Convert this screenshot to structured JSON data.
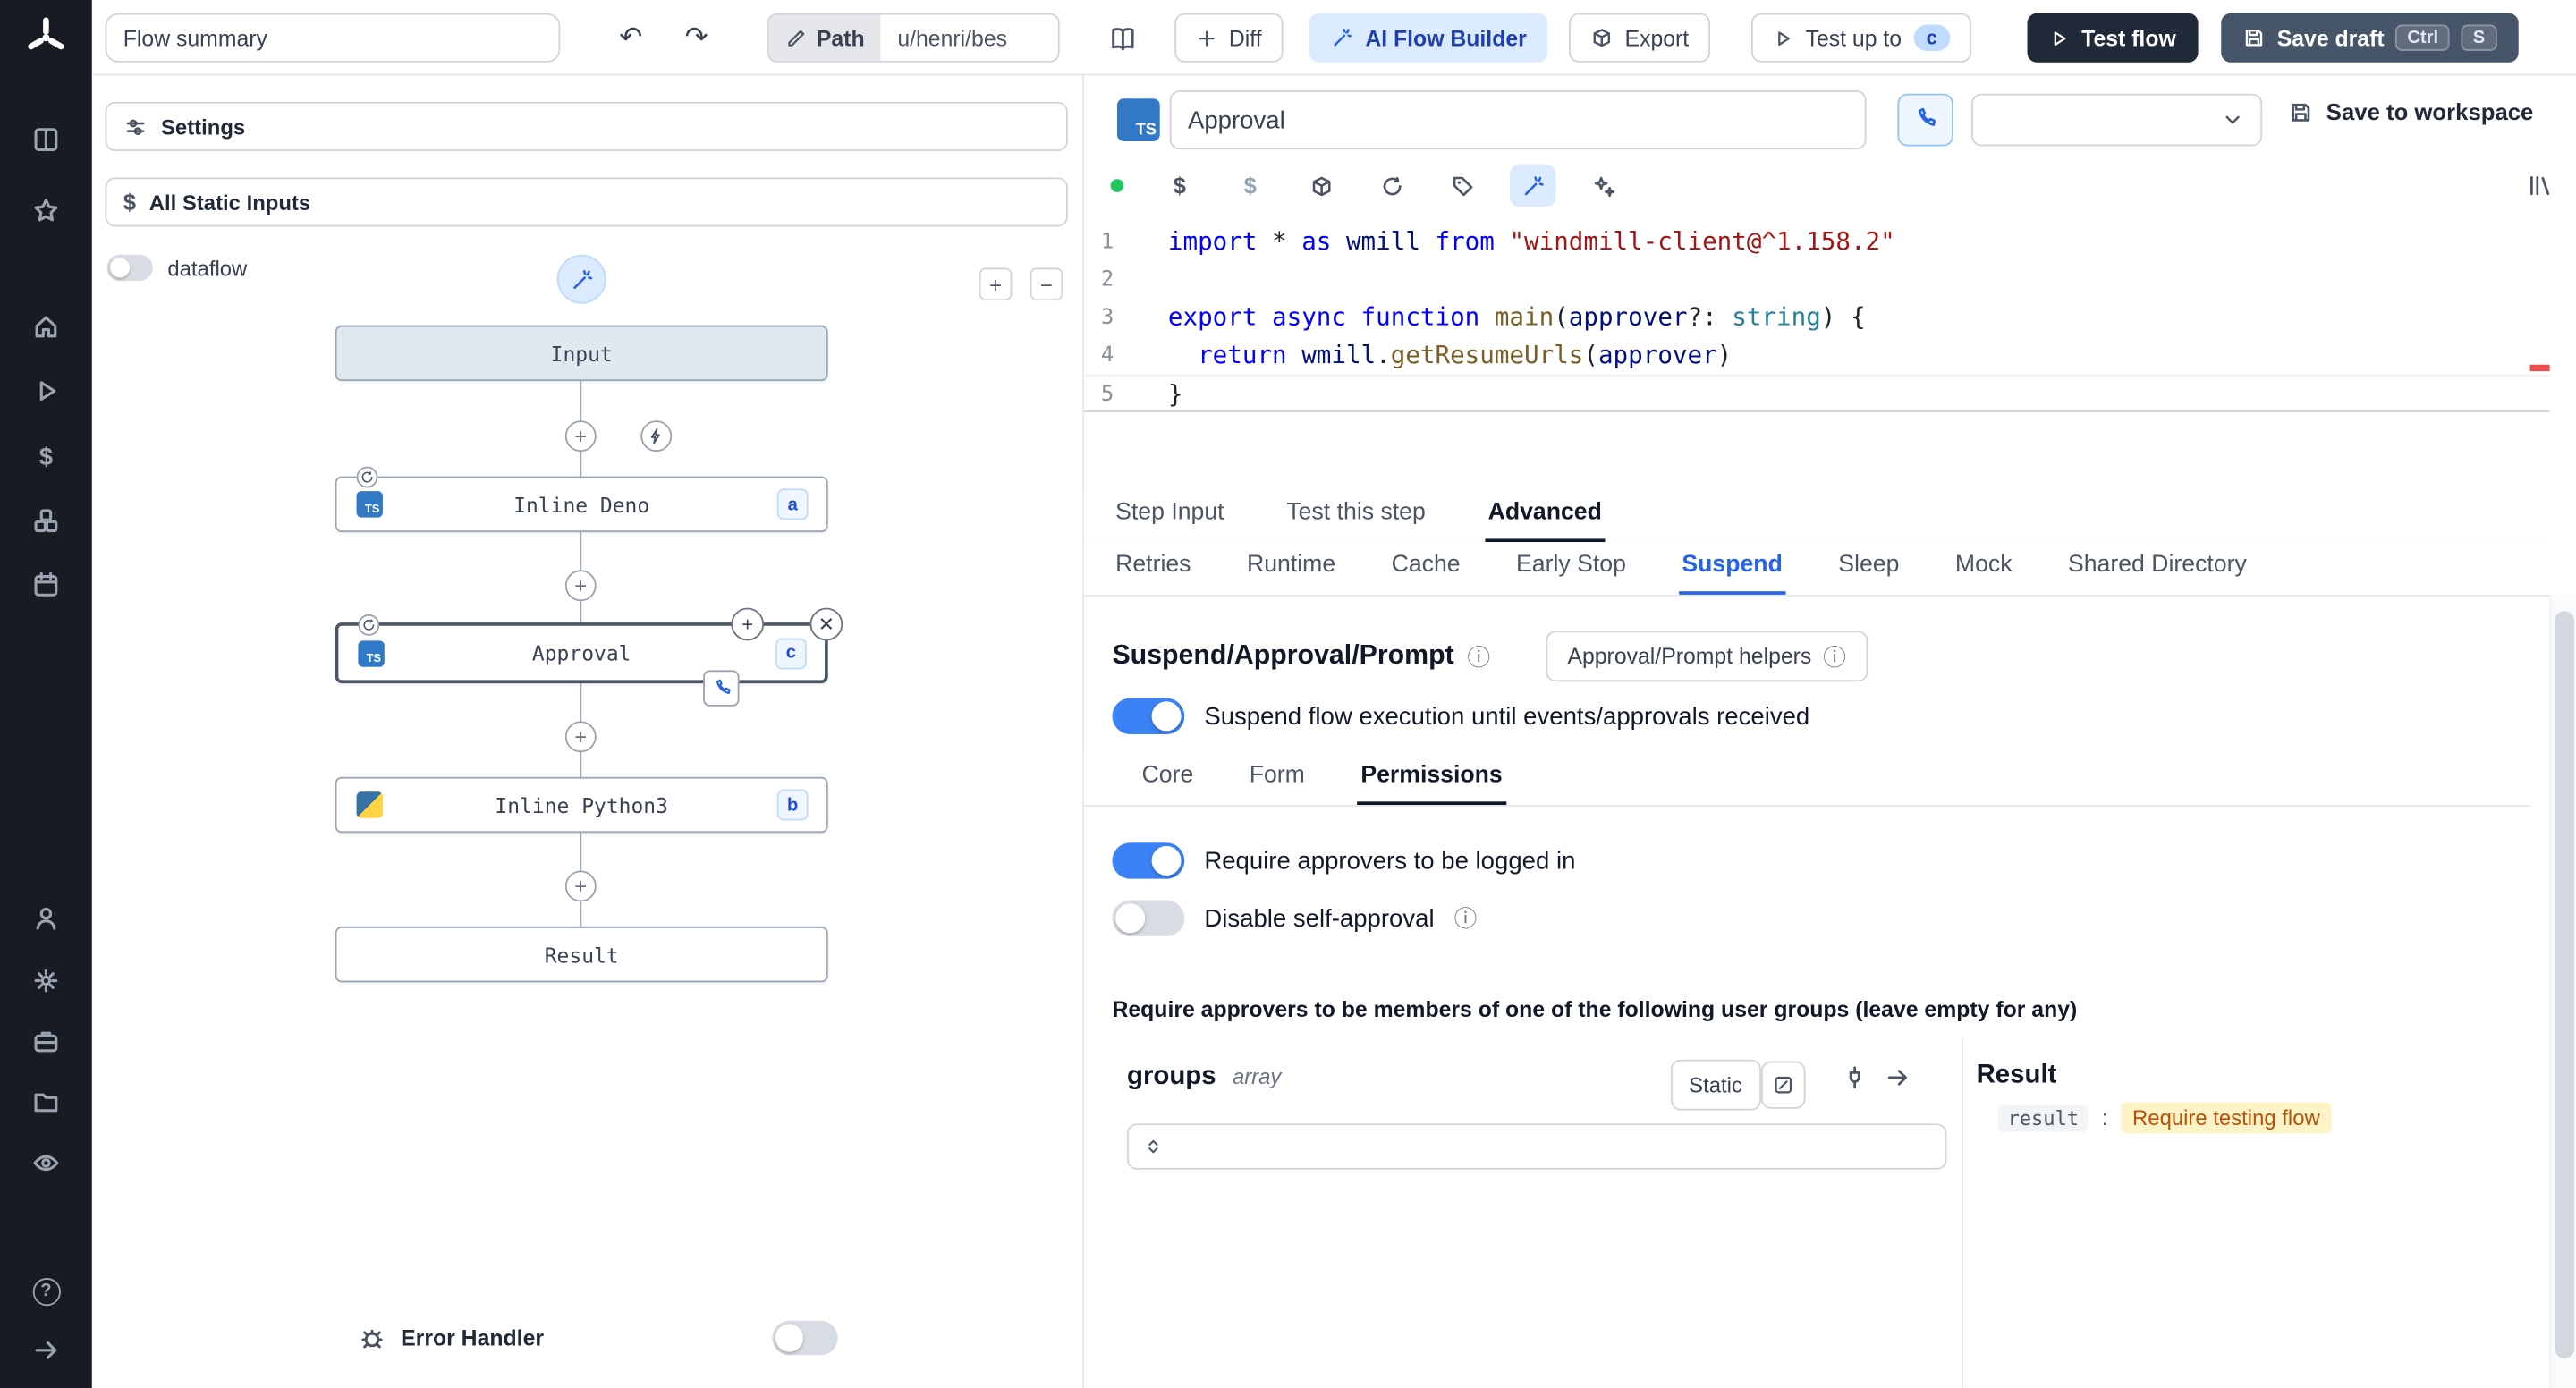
{
  "colors": {
    "accent_blue": "#3b82f6",
    "tab_active_blue": "#2563eb",
    "ai_button_bg": "#dbeafe",
    "ai_button_text": "#1e40af",
    "dark_button_bg": "#1f2937",
    "save_draft_bg": "#475569",
    "toggle_on": "#3b82f6",
    "ts_icon_bg": "#3178c6",
    "status_dot_green": "#22c55e",
    "result_highlight_bg": "#fef3c7",
    "result_highlight_text": "#b45309",
    "syntax": {
      "keyword": "#0000ff",
      "string": "#a31515",
      "function": "#795e26",
      "variable": "#001080",
      "type": "#267f99"
    }
  },
  "topbar": {
    "flow_summary_value": "Flow summary",
    "path_button": "Path",
    "path_value": "u/henri/bes",
    "diff_button": "Diff",
    "ai_flow_builder_button": "AI Flow Builder",
    "export_button": "Export",
    "test_up_to_button": "Test up to",
    "test_up_to_badge": "c",
    "test_flow_button": "Test flow",
    "save_draft_button": "Save draft",
    "save_draft_kbd": [
      "Ctrl",
      "S"
    ]
  },
  "sidebar": {
    "icon_names": [
      "windmill-logo",
      "runs",
      "favorites",
      "home",
      "jobs",
      "variables",
      "resources",
      "schedules",
      "users",
      "settings",
      "workers",
      "folders",
      "audit-logs",
      "help",
      "collapse"
    ]
  },
  "flow_panel": {
    "settings_label": "Settings",
    "all_static_inputs_label": "All Static Inputs",
    "dataflow_label": "dataflow",
    "zoom_in": "+",
    "zoom_out": "−",
    "nodes": {
      "input": {
        "label": "Input"
      },
      "deno": {
        "label": "Inline Deno",
        "badge": "a"
      },
      "approval": {
        "label": "Approval",
        "badge": "c"
      },
      "python": {
        "label": "Inline Python3",
        "badge": "b"
      },
      "result": {
        "label": "Result"
      }
    },
    "error_handler_label": "Error Handler"
  },
  "step_panel": {
    "step_name_value": "Approval",
    "save_to_workspace_button": "Save to workspace",
    "editor": {
      "current_line": 5,
      "lines": [
        {
          "n": "1",
          "tokens": [
            [
              "kw",
              "import"
            ],
            [
              "pl",
              " * "
            ],
            [
              "kw",
              "as"
            ],
            [
              "var",
              " wmill "
            ],
            [
              "kw",
              "from"
            ],
            [
              "pl",
              " "
            ],
            [
              "str",
              "\"windmill-client@^1.158.2\""
            ]
          ]
        },
        {
          "n": "2",
          "tokens": []
        },
        {
          "n": "3",
          "tokens": [
            [
              "kw",
              "export"
            ],
            [
              "pl",
              " "
            ],
            [
              "kw",
              "async"
            ],
            [
              "pl",
              " "
            ],
            [
              "kw",
              "function"
            ],
            [
              "pl",
              " "
            ],
            [
              "fn",
              "main"
            ],
            [
              "pl",
              "("
            ],
            [
              "var",
              "approver"
            ],
            [
              "pl",
              "?: "
            ],
            [
              "ty",
              "string"
            ],
            [
              "pl",
              ") {"
            ]
          ]
        },
        {
          "n": "4",
          "tokens": [
            [
              "pl",
              "  "
            ],
            [
              "kw",
              "return"
            ],
            [
              "pl",
              " "
            ],
            [
              "var",
              "wmill"
            ],
            [
              "pl",
              "."
            ],
            [
              "fn",
              "getResumeUrls"
            ],
            [
              "pl",
              "("
            ],
            [
              "var",
              "approver"
            ],
            [
              "pl",
              ")"
            ]
          ]
        },
        {
          "n": "5",
          "tokens": [
            [
              "pl",
              "}"
            ]
          ]
        }
      ]
    },
    "tabs": {
      "items": [
        "Step Input",
        "Test this step",
        "Advanced"
      ],
      "active": "Advanced"
    },
    "advanced_tabs": {
      "items": [
        "Retries",
        "Runtime",
        "Cache",
        "Early Stop",
        "Suspend",
        "Sleep",
        "Mock",
        "Shared Directory"
      ],
      "active": "Suspend"
    },
    "suspend": {
      "title": "Suspend/Approval/Prompt",
      "helpers_button": "Approval/Prompt helpers",
      "suspend_toggle_label": "Suspend flow execution until events/approvals received",
      "sub_tabs": {
        "items": [
          "Core",
          "Form",
          "Permissions"
        ],
        "active": "Permissions"
      },
      "require_login_label": "Require approvers to be logged in",
      "disable_self_approval_label": "Disable self-approval",
      "groups_note": "Require approvers to be members of one of the following user groups (leave empty for any)",
      "groups_field": {
        "name": "groups",
        "type": "array",
        "static_button": "Static"
      },
      "result": {
        "title": "Result",
        "key": "result",
        "value": "Require testing flow"
      }
    }
  }
}
